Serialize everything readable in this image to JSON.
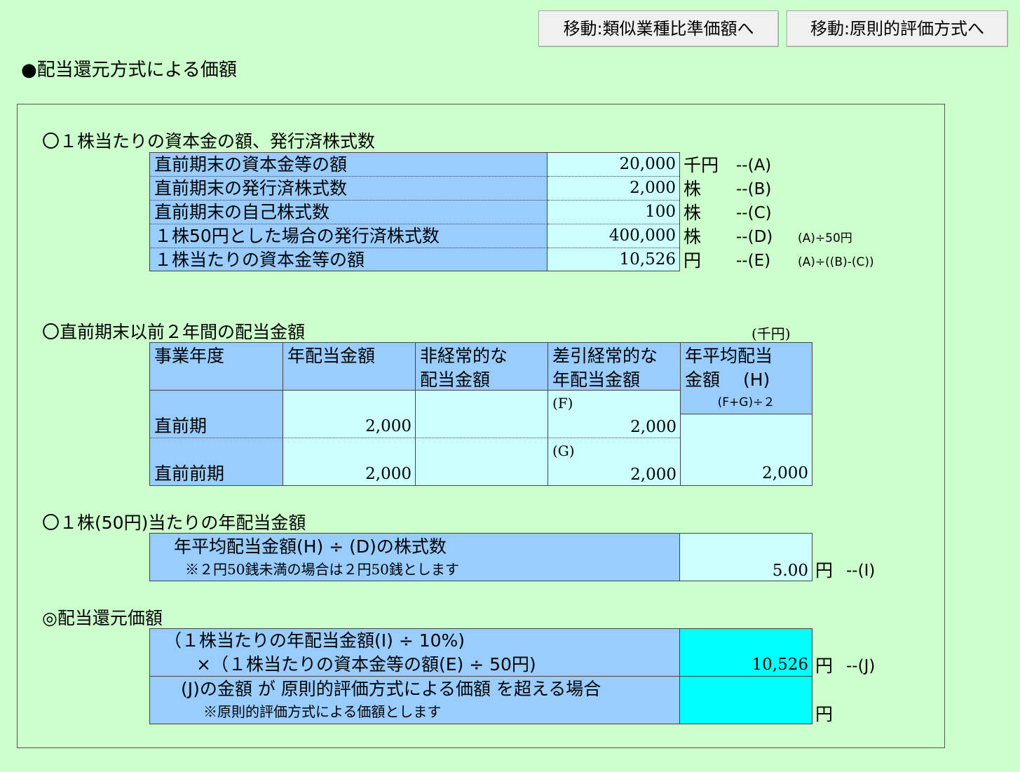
{
  "nav": {
    "to_similar_label": "移動:類似業種比準価額へ",
    "to_principle_label": "移動:原則的評価方式へ"
  },
  "page_title": "●配当還元方式による価額",
  "capital": {
    "heading": "〇１株当たりの資本金の額、発行済株式数",
    "rows": [
      {
        "label": "直前期末の資本金等の額",
        "value": "20,000",
        "unit": "千円",
        "ref": "--(A)",
        "formula": ""
      },
      {
        "label": "直前期末の発行済株式数",
        "value": "2,000",
        "unit": "株",
        "ref": "--(B)",
        "formula": ""
      },
      {
        "label": "直前期末の自己株式数",
        "value": "100",
        "unit": "株",
        "ref": "--(C)",
        "formula": ""
      },
      {
        "label": "１株50円とした場合の発行済株式数",
        "value": "400,000",
        "unit": "株",
        "ref": "--(D)",
        "formula": "(A)÷50円"
      },
      {
        "label": "１株当たりの資本金等の額",
        "value": "10,526",
        "unit": "円",
        "ref": "--(E)",
        "formula": "(A)÷((B)-(C))"
      }
    ]
  },
  "dividend": {
    "heading": "〇直前期末以前２年間の配当金額",
    "unit_note": "(千円)",
    "headers": {
      "year": "事業年度",
      "annual_line1": "年配当金額",
      "extra_line1": "非経常的な",
      "extra_line2": "配当金額",
      "diff_line1": "差引経常的な",
      "diff_line2": "年配当金額",
      "avg_line1": "年平均配当",
      "avg_line2": "金額　 (H)",
      "avg_formula": "(F+G)÷２"
    },
    "rows": [
      {
        "year": "直前期",
        "annual": "2,000",
        "extra": "",
        "diff_tag": "(F)",
        "diff": "2,000"
      },
      {
        "year": "直前前期",
        "annual": "2,000",
        "extra": "",
        "diff_tag": "(G)",
        "diff": "2,000"
      }
    ],
    "average": "2,000"
  },
  "per_share": {
    "heading": "〇１株(50円)当たりの年配当金額",
    "label": "年平均配当金額(H) ÷ (D)の株式数",
    "note": "※２円50銭未満の場合は２円50銭とします",
    "value": "5.00",
    "unit": "円",
    "ref": "--(I)"
  },
  "return_value": {
    "heading": "◎配当還元価額",
    "formula_line1": "（１株当たりの年配当金額(I) ÷ 10%)",
    "formula_line2": "×（１株当たりの資本金等の額(E) ÷ 50円)",
    "value": "10,526",
    "unit": "円",
    "ref": "--(J)",
    "exceed_label": "(J)の金額 が 原則的評価方式による価額 を超える場合",
    "exceed_note": "※原則的評価方式による価額とします",
    "exceed_value": "",
    "exceed_unit": "円"
  }
}
